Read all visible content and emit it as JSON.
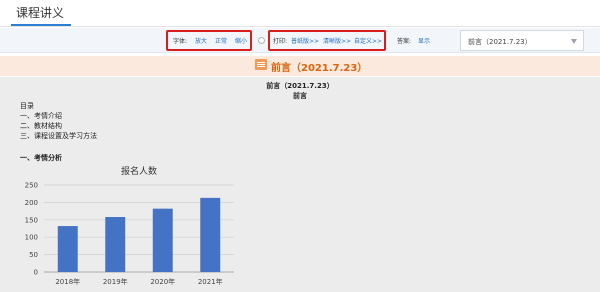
{
  "tabs": [
    {
      "label": "课程讲义"
    }
  ],
  "toolbar": {
    "font_label": "字体:",
    "font_links": [
      "放大",
      "正常",
      "缩小"
    ],
    "print_label": "打印:",
    "print_links": [
      "普纸版>>",
      "清晰版>>",
      "自定义>>"
    ],
    "answer_label": "答案:",
    "answer_link": "显示",
    "select_value": "前言（2021.7.23）"
  },
  "section": {
    "title": "前言（2021.7.23）"
  },
  "doc": {
    "heading_line1": "前言（2021.7.23）",
    "heading_line2": "前言",
    "toc_title": "目录",
    "toc": [
      "一、考情介绍",
      "二、教材结构",
      "三、课程设置及学习方法"
    ],
    "subheading": "一、考情分析"
  },
  "colors": {
    "accent": "#2d7fd3",
    "link": "#1f6fc4",
    "highlight": "#d91c1c",
    "bar": "#4472c4",
    "section_bg": "#fbe9dd",
    "section_text": "#d9650e"
  },
  "chart_data": {
    "type": "bar",
    "title": "报名人数",
    "categories": [
      "2018年",
      "2019年",
      "2020年",
      "2021年"
    ],
    "values": [
      132,
      158,
      182,
      213
    ],
    "ylim": [
      0,
      250
    ],
    "yticks": [
      0,
      50,
      100,
      150,
      200,
      250
    ],
    "grid": true,
    "xlabel": "",
    "ylabel": ""
  }
}
